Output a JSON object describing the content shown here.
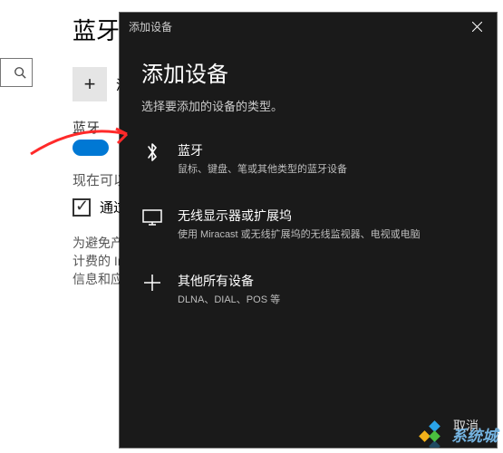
{
  "settings": {
    "page_title": "蓝牙和",
    "search_placeholder": "",
    "add_device_label": "添",
    "bluetooth_section": "蓝牙",
    "now_available": "现在可以",
    "filter_label": "通过技",
    "note_line1": "为避免产生",
    "note_line2": "计费的 Int",
    "note_line3": "信息和应用"
  },
  "dialog": {
    "header_title": "添加设备",
    "title": "添加设备",
    "subtitle": "选择要添加的设备的类型。",
    "options": [
      {
        "key": "bluetooth",
        "title": "蓝牙",
        "desc": "鼠标、键盘、笔或其他类型的蓝牙设备"
      },
      {
        "key": "wireless-display",
        "title": "无线显示器或扩展坞",
        "desc": "使用 Miracast 或无线扩展坞的无线监视器、电视或电脑"
      },
      {
        "key": "other",
        "title": "其他所有设备",
        "desc": "DLNA、DIAL、POS 等"
      }
    ],
    "cancel": "取消"
  },
  "watermark": "系统城"
}
